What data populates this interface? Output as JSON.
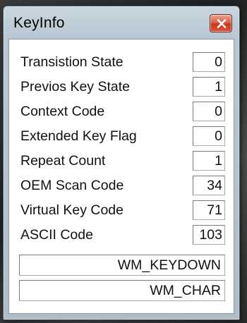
{
  "window": {
    "title": "KeyInfo"
  },
  "fields": [
    {
      "label": "Transistion State",
      "value": "0"
    },
    {
      "label": "Previos Key State",
      "value": "1"
    },
    {
      "label": "Context Code",
      "value": "0"
    },
    {
      "label": "Extended Key Flag",
      "value": "0"
    },
    {
      "label": "Repeat Count",
      "value": "1"
    },
    {
      "label": "OEM Scan Code",
      "value": "34"
    },
    {
      "label": "Virtual Key Code",
      "value": "71"
    },
    {
      "label": "ASCII Code",
      "value": "103"
    }
  ],
  "messages": [
    "WM_KEYDOWN",
    "WM_CHAR"
  ],
  "icons": {
    "close": "close-icon"
  },
  "colors": {
    "close_button": "#d8563c",
    "window_frame": "#b8c7d2"
  }
}
